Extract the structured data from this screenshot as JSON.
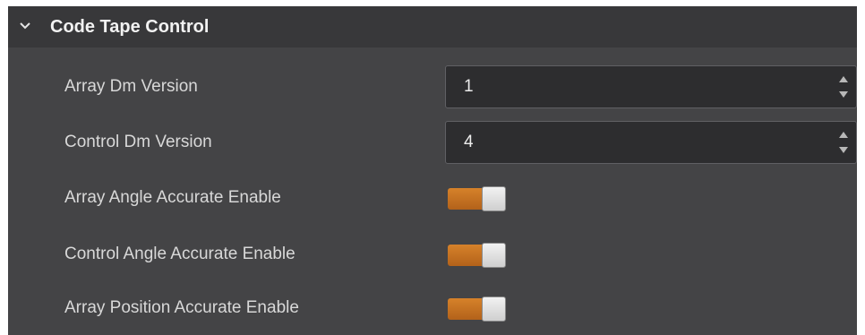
{
  "section": {
    "title": "Code Tape Control",
    "icon": "chevron-down-icon",
    "expanded": true
  },
  "rows": [
    {
      "label": "Array Dm Version",
      "type": "spinbox",
      "value": "1"
    },
    {
      "label": "Control Dm Version",
      "type": "spinbox",
      "value": "4"
    },
    {
      "label": "Array Angle Accurate Enable",
      "type": "toggle",
      "checked": true
    },
    {
      "label": "Control Angle Accurate Enable",
      "type": "toggle",
      "checked": true
    },
    {
      "label": "Array Position Accurate Enable",
      "type": "toggle",
      "checked": true
    }
  ],
  "colors": {
    "panel_bg": "#444446",
    "header_bg": "#38383a",
    "input_bg": "#2d2d2f",
    "toggle_on": "#c8701f",
    "text": "#d8d8d8"
  }
}
